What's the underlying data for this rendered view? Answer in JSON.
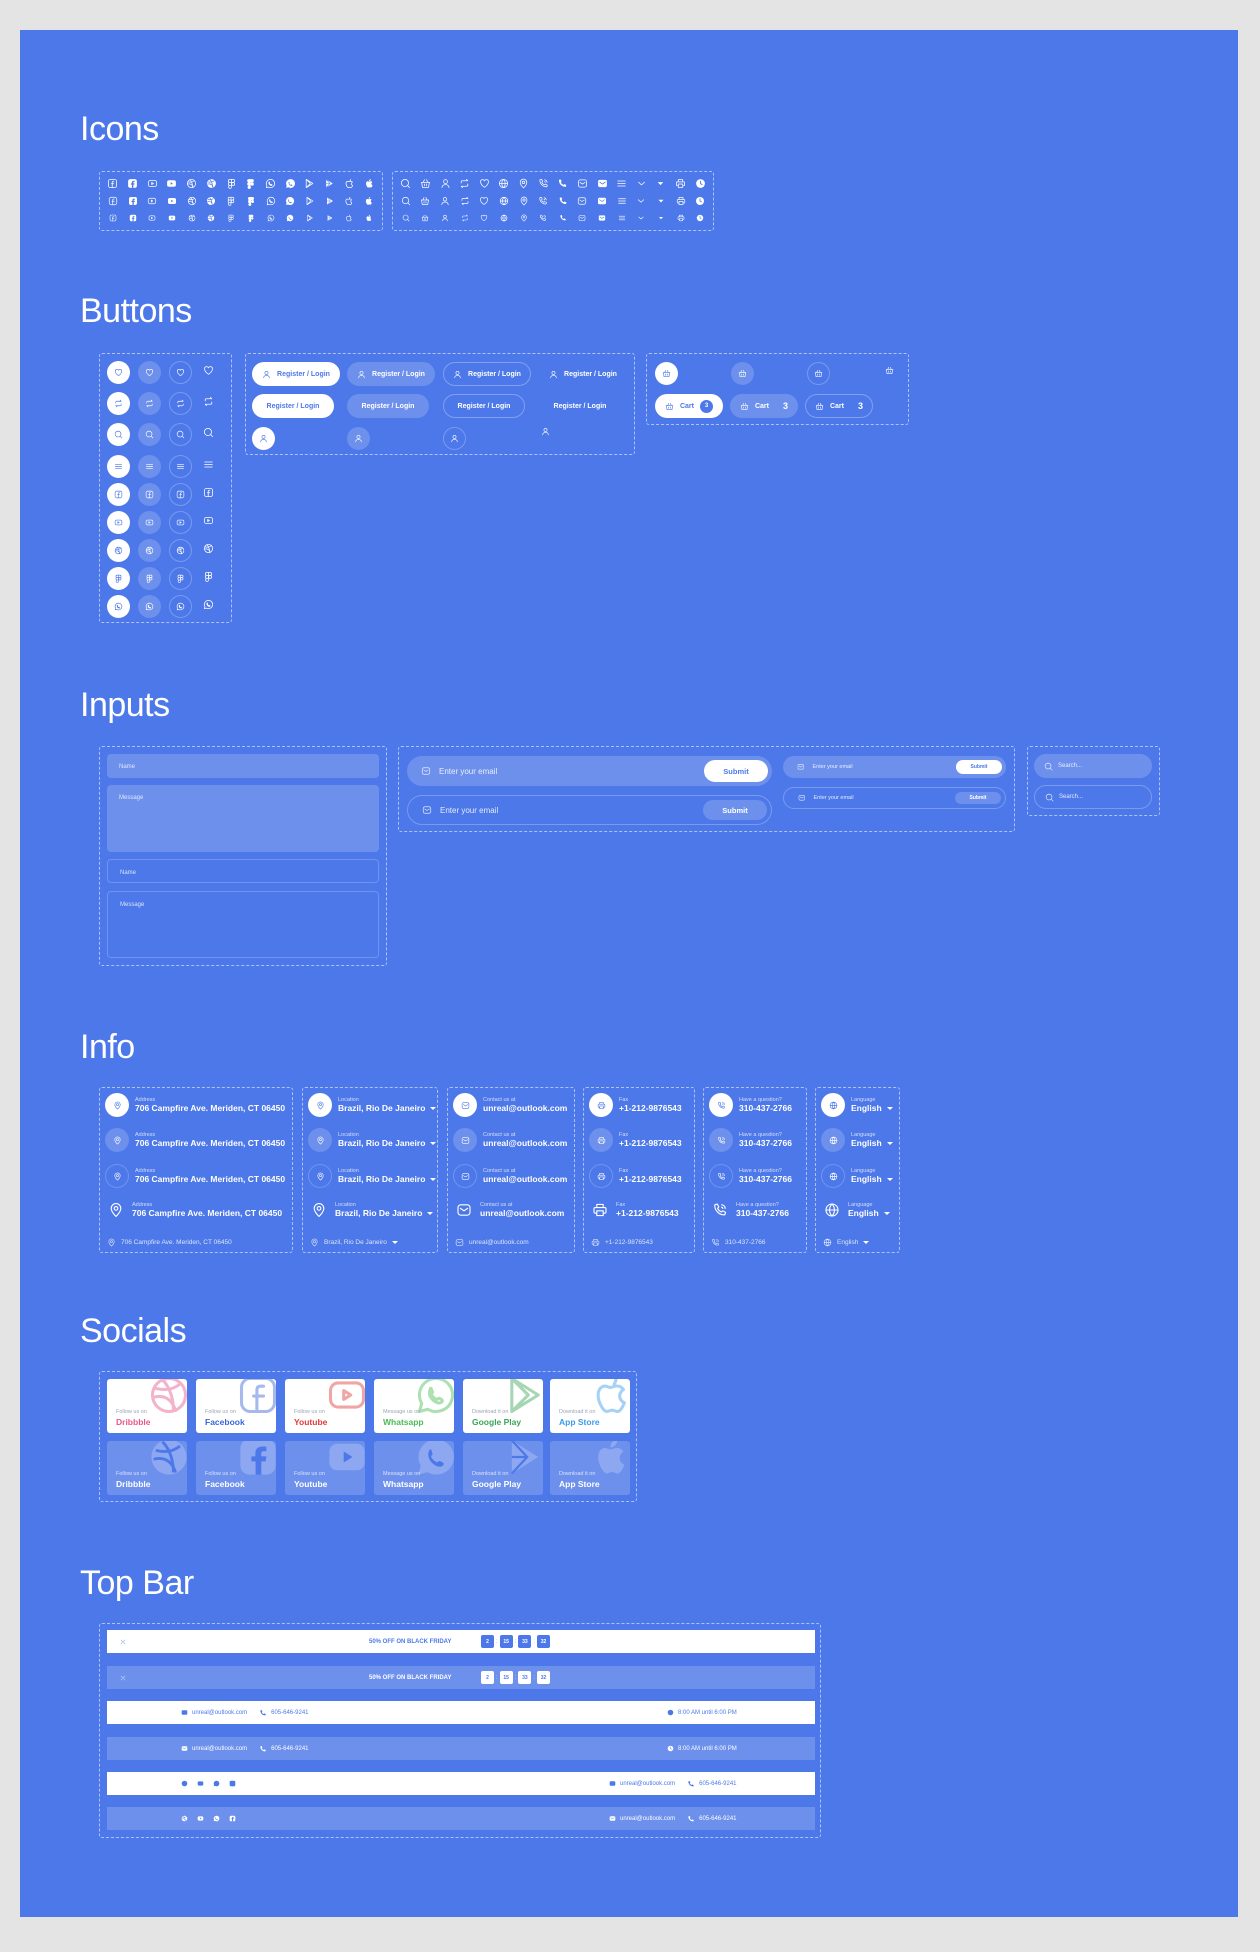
{
  "sections": {
    "icons": "Icons",
    "buttons": "Buttons",
    "inputs": "Inputs",
    "info": "Info",
    "socials": "Socials",
    "topbar": "Top Bar"
  },
  "icons": {
    "social_set": [
      "facebook-outline",
      "facebook-filled",
      "youtube-outline",
      "youtube-filled",
      "dribbble-outline",
      "dribbble-filled",
      "figma-outline",
      "figma-filled",
      "whatsapp-outline",
      "whatsapp-filled",
      "google-play-outline",
      "google-play-filled",
      "apple-outline",
      "apple-filled"
    ],
    "ui_set": [
      "search",
      "basket",
      "user",
      "repeat",
      "heart",
      "globe",
      "location",
      "phone-outline",
      "phone-filled",
      "mail-outline",
      "mail-filled",
      "menu",
      "chevron-down",
      "caret-down",
      "printer",
      "clock"
    ],
    "rows": 3
  },
  "buttons": {
    "icon_buttons": [
      "heart",
      "repeat",
      "search",
      "menu",
      "facebook",
      "youtube",
      "dribbble",
      "figma",
      "whatsapp"
    ],
    "register_label": "Register / Login",
    "cart_label": "Cart",
    "cart_count": "3"
  },
  "inputs": {
    "name_placeholder": "Name",
    "message_placeholder": "Message",
    "email_placeholder": "Enter your email",
    "submit_label": "Submit",
    "search_placeholder": "Search..."
  },
  "info": {
    "address": {
      "label": "Address",
      "value": "706 Campfire Ave. Meriden, CT 06450"
    },
    "location": {
      "label": "Location",
      "value": "Brazil, Rio De Janeiro"
    },
    "contact": {
      "label": "Contact us at",
      "value": "unreal@outlook.com"
    },
    "fax": {
      "label": "Fax",
      "value": "+1-212-9876543"
    },
    "question": {
      "label": "Have a question?",
      "value": "310-437-2766"
    },
    "language": {
      "label": "Language",
      "value": "English"
    }
  },
  "socials": [
    {
      "pre": "Follow us on",
      "name": "Dribbble",
      "color": "#e5588a",
      "icon": "dribbble"
    },
    {
      "pre": "Follow us on",
      "name": "Facebook",
      "color": "#3a66d9",
      "icon": "facebook"
    },
    {
      "pre": "Follow us on",
      "name": "Youtube",
      "color": "#e03a3a",
      "icon": "youtube"
    },
    {
      "pre": "Message us on",
      "name": "Whatsapp",
      "color": "#4cbb55",
      "icon": "whatsapp"
    },
    {
      "pre": "Download it on",
      "name": "Google Play",
      "color": "#3aa55a",
      "icon": "google-play"
    },
    {
      "pre": "Download it on",
      "name": "App Store",
      "color": "#3b9be8",
      "icon": "apple"
    }
  ],
  "topbar": {
    "promo": "50% OFF ON BLACK FRIDAY",
    "timer": [
      "2",
      "15",
      "33",
      "32"
    ],
    "email": "unreal@outlook.com",
    "phone": "605-646-9241",
    "hours": "8:00 AM until 6:00 PM"
  },
  "colors": {
    "background": "#4d78e9",
    "page": "#e4e4e4",
    "white": "#ffffff"
  }
}
